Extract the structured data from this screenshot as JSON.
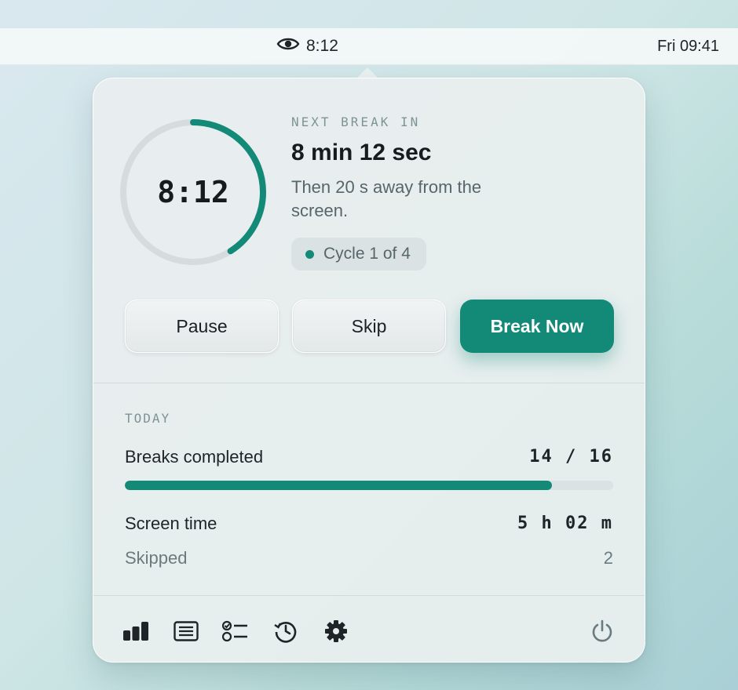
{
  "menubar": {
    "app_icon": "eye-icon",
    "countdown": "8:12",
    "clock": "Fri 09:41"
  },
  "timer": {
    "display": "8:12",
    "next_label": "NEXT BREAK IN",
    "next_time": "8 min 12 sec",
    "description": "Then 20 s away from the screen.",
    "cycle": "Cycle 1 of 4",
    "progress_fraction": 0.41
  },
  "buttons": {
    "pause": "Pause",
    "skip": "Skip",
    "break_now": "Break Now"
  },
  "today": {
    "label": "TODAY",
    "breaks_label": "Breaks completed",
    "breaks_value": "14 / 16",
    "breaks_fraction": 0.875,
    "screen_time_label": "Screen time",
    "screen_time_value": "5 h 02 m",
    "skipped_label": "Skipped",
    "skipped_value": "2"
  },
  "footer": {
    "icons": [
      "bar-chart-icon",
      "list-icon",
      "checklist-icon",
      "history-icon",
      "gear-icon",
      "power-icon"
    ]
  },
  "colors": {
    "accent": "#138a78",
    "track": "#d6dcdd"
  }
}
